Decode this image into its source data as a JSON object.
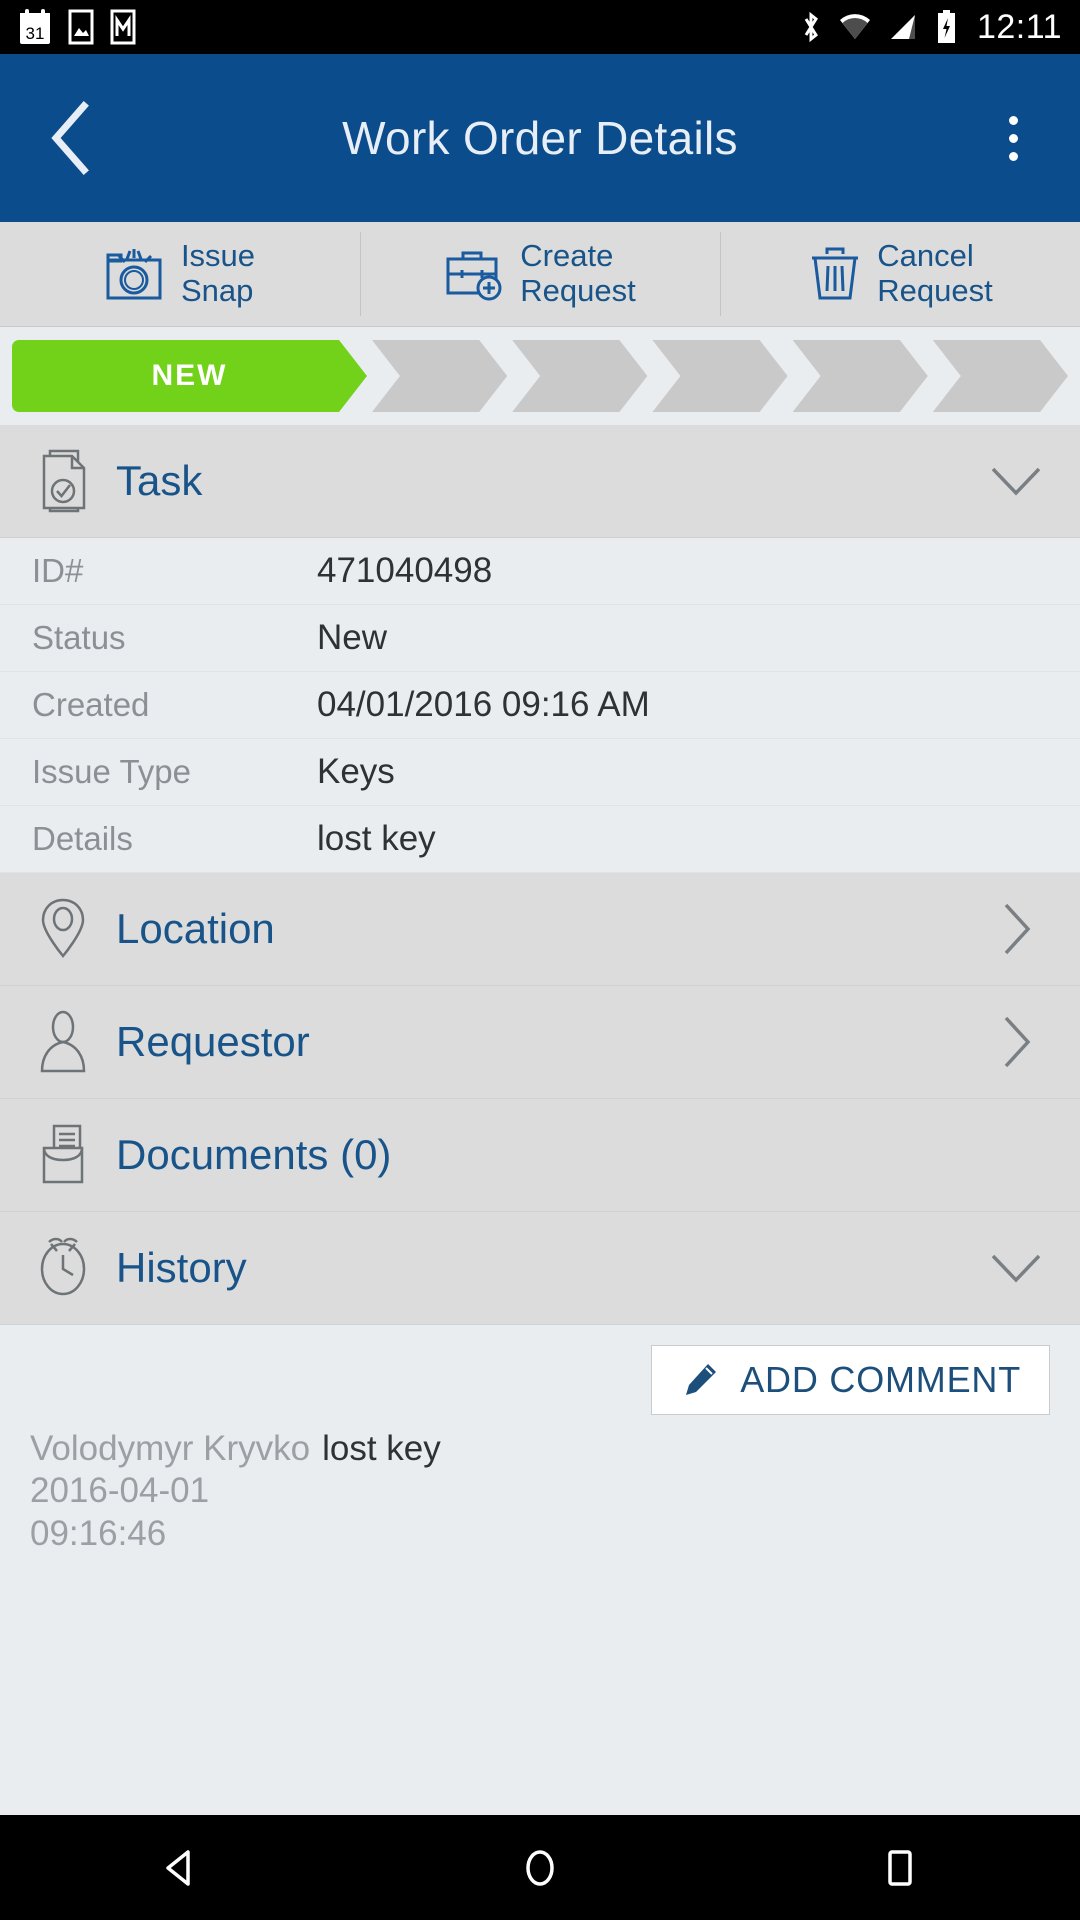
{
  "statusbar": {
    "time": "12:11",
    "left_icons": [
      "calendar-icon",
      "photos-icon",
      "gmail-icon"
    ],
    "right_icons": [
      "bluetooth-icon",
      "wifi-icon",
      "signal-icon",
      "battery-charging-icon"
    ]
  },
  "appbar": {
    "title": "Work Order Details",
    "back_icon": "back-chevron-icon",
    "overflow_icon": "overflow-menu-icon",
    "background": "#0b4c8c"
  },
  "actions": [
    {
      "label": "Issue\nSnap",
      "icon": "camera-icon"
    },
    {
      "label": "Create\nRequest",
      "icon": "briefcase-plus-icon"
    },
    {
      "label": "Cancel\nRequest",
      "icon": "trash-icon"
    }
  ],
  "progress": {
    "active_label": "NEW",
    "active_color": "#72d119",
    "inactive_color": "#c9c9c9",
    "total_steps": 6,
    "active_index": 0
  },
  "task_section": {
    "title": "Task",
    "icon": "document-check-icon",
    "caret": "chevron-down-icon",
    "rows": [
      {
        "label": "ID#",
        "value": "471040498"
      },
      {
        "label": "Status",
        "value": "New"
      },
      {
        "label": "Created",
        "value": "04/01/2016 09:16 AM"
      },
      {
        "label": "Issue Type",
        "value": "Keys"
      },
      {
        "label": "Details",
        "value": "lost key"
      }
    ]
  },
  "sections": [
    {
      "title": "Location",
      "icon": "map-pin-icon",
      "caret": "chevron-right-icon"
    },
    {
      "title": "Requestor",
      "icon": "person-icon",
      "caret": "chevron-right-icon"
    },
    {
      "title": "Documents (0)",
      "icon": "file-tray-icon",
      "caret": ""
    },
    {
      "title": "History",
      "icon": "clock-icon",
      "caret": "chevron-down-icon"
    }
  ],
  "comments": {
    "add_label": "ADD COMMENT",
    "add_icon": "pencil-icon",
    "entries": [
      {
        "author": "Volodymyr Kryvko",
        "text": "lost key",
        "date": "2016-04-01",
        "time": "09:16:46"
      }
    ]
  },
  "navbar": {
    "back_icon": "nav-back-icon",
    "home_icon": "nav-home-icon",
    "recents_icon": "nav-recents-icon"
  },
  "colors": {
    "primary": "#0b4c8c",
    "link": "#185489",
    "accent_green": "#72d119",
    "page_bg": "#e9edf0",
    "section_bg": "#dcdcdc"
  }
}
